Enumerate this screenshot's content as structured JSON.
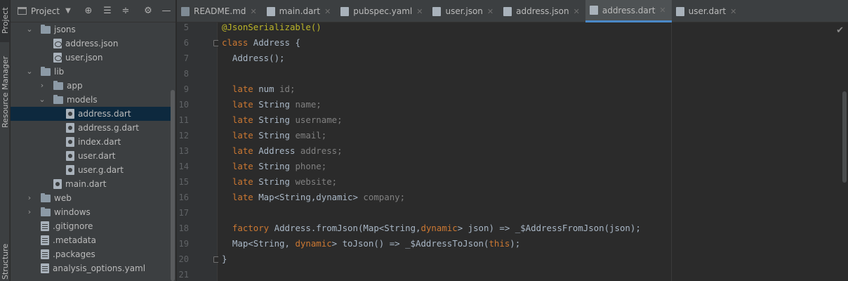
{
  "left_stripe": {
    "project": "Project",
    "resource_manager": "Resource Manager",
    "structure": "Structure"
  },
  "panel": {
    "title": "Project",
    "icons": [
      "locate-icon",
      "expand-all-icon",
      "collapse-all-icon",
      "gear-icon",
      "minimize-icon"
    ]
  },
  "tree": [
    {
      "label": "jsons",
      "kind": "folder",
      "depth": 1,
      "expanded": true
    },
    {
      "label": "address.json",
      "kind": "json",
      "depth": 2
    },
    {
      "label": "user.json",
      "kind": "json",
      "depth": 2
    },
    {
      "label": "lib",
      "kind": "folder",
      "depth": 1,
      "expanded": true
    },
    {
      "label": "app",
      "kind": "folder",
      "depth": 2,
      "expanded": false
    },
    {
      "label": "models",
      "kind": "folder",
      "depth": 2,
      "expanded": true
    },
    {
      "label": "address.dart",
      "kind": "dart",
      "depth": 3,
      "selected": true
    },
    {
      "label": "address.g.dart",
      "kind": "dart",
      "depth": 3
    },
    {
      "label": "index.dart",
      "kind": "dart",
      "depth": 3
    },
    {
      "label": "user.dart",
      "kind": "dart",
      "depth": 3
    },
    {
      "label": "user.g.dart",
      "kind": "dart",
      "depth": 3
    },
    {
      "label": "main.dart",
      "kind": "dart",
      "depth": 2
    },
    {
      "label": "web",
      "kind": "folder",
      "depth": 1,
      "expanded": false
    },
    {
      "label": "windows",
      "kind": "folder",
      "depth": 1,
      "expanded": false
    },
    {
      "label": ".gitignore",
      "kind": "txt",
      "depth": 1
    },
    {
      "label": ".metadata",
      "kind": "txt",
      "depth": 1
    },
    {
      "label": ".packages",
      "kind": "txt",
      "depth": 1
    },
    {
      "label": "analysis_options.yaml",
      "kind": "txt",
      "depth": 1
    }
  ],
  "tabs": [
    {
      "label": "README.md",
      "icon": "markdown-file-icon",
      "closable": true
    },
    {
      "label": "main.dart",
      "icon": "dart-file-icon",
      "closable": true
    },
    {
      "label": "pubspec.yaml",
      "icon": "yaml-file-icon",
      "closable": true
    },
    {
      "label": "user.json",
      "icon": "json-file-icon",
      "closable": true
    },
    {
      "label": "address.json",
      "icon": "json-file-icon",
      "closable": true
    },
    {
      "label": "address.dart",
      "icon": "dart-file-icon",
      "closable": true,
      "active": true
    },
    {
      "label": "user.dart",
      "icon": "dart-file-icon",
      "closable": true
    }
  ],
  "editor": {
    "line_numbers": [
      "5",
      "6",
      "7",
      "8",
      "9",
      "10",
      "11",
      "12",
      "13",
      "14",
      "15",
      "16",
      "17",
      "18",
      "19",
      "20",
      "21"
    ],
    "lines": [
      [
        {
          "t": "@JsonSerializable()",
          "c": "an"
        }
      ],
      [
        {
          "t": "class ",
          "c": "kw"
        },
        {
          "t": "Address {",
          "c": ""
        }
      ],
      [
        {
          "t": "  Address();",
          "c": ""
        }
      ],
      [],
      [
        {
          "t": "  late ",
          "c": "kw"
        },
        {
          "t": "num ",
          "c": "ty"
        },
        {
          "t": "id;",
          "c": "dim"
        }
      ],
      [
        {
          "t": "  late ",
          "c": "kw"
        },
        {
          "t": "String ",
          "c": "ty"
        },
        {
          "t": "name;",
          "c": "dim"
        }
      ],
      [
        {
          "t": "  late ",
          "c": "kw"
        },
        {
          "t": "String ",
          "c": "ty"
        },
        {
          "t": "username;",
          "c": "dim"
        }
      ],
      [
        {
          "t": "  late ",
          "c": "kw"
        },
        {
          "t": "String ",
          "c": "ty"
        },
        {
          "t": "email;",
          "c": "dim"
        }
      ],
      [
        {
          "t": "  late ",
          "c": "kw"
        },
        {
          "t": "Address ",
          "c": "ty"
        },
        {
          "t": "address;",
          "c": "dim"
        }
      ],
      [
        {
          "t": "  late ",
          "c": "kw"
        },
        {
          "t": "String ",
          "c": "ty"
        },
        {
          "t": "phone;",
          "c": "dim"
        }
      ],
      [
        {
          "t": "  late ",
          "c": "kw"
        },
        {
          "t": "String ",
          "c": "ty"
        },
        {
          "t": "website;",
          "c": "dim"
        }
      ],
      [
        {
          "t": "  late ",
          "c": "kw"
        },
        {
          "t": "Map<String,dynamic> ",
          "c": "ty"
        },
        {
          "t": "company;",
          "c": "dim"
        }
      ],
      [],
      [
        {
          "t": "  factory ",
          "c": "kw"
        },
        {
          "t": "Address.fromJson(Map<String,",
          "c": ""
        },
        {
          "t": "dynamic",
          "c": "kw"
        },
        {
          "t": "> json) => _$AddressFromJson(json);",
          "c": ""
        }
      ],
      [
        {
          "t": "  Map<String, ",
          "c": ""
        },
        {
          "t": "dynamic",
          "c": "kw"
        },
        {
          "t": "> toJson() => _$AddressToJson(",
          "c": ""
        },
        {
          "t": "this",
          "c": "kw"
        },
        {
          "t": ");",
          "c": ""
        }
      ],
      [
        {
          "t": "}",
          "c": ""
        }
      ],
      []
    ]
  },
  "colors": {
    "accent": "#4a88c7",
    "selection": "#0d293e",
    "keyword": "#cc7832",
    "annotation": "#bbb529"
  }
}
